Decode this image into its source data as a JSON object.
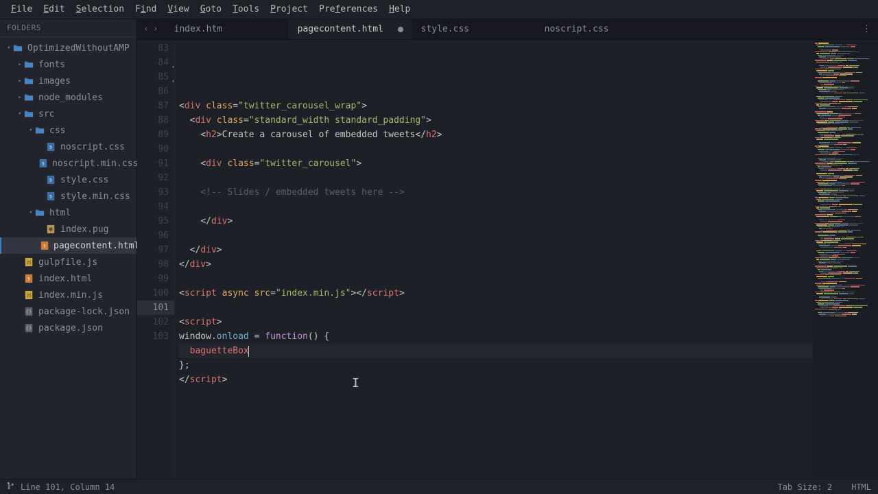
{
  "menu": {
    "items": [
      {
        "label": "File",
        "u": 0
      },
      {
        "label": "Edit",
        "u": 0
      },
      {
        "label": "Selection",
        "u": 0
      },
      {
        "label": "Find",
        "u": 1
      },
      {
        "label": "View",
        "u": 0
      },
      {
        "label": "Goto",
        "u": 0
      },
      {
        "label": "Tools",
        "u": 0
      },
      {
        "label": "Project",
        "u": 0
      },
      {
        "label": "Preferences",
        "u": 3
      },
      {
        "label": "Help",
        "u": 0
      }
    ]
  },
  "sidebar": {
    "header": "FOLDERS",
    "tree": [
      {
        "depth": 0,
        "kind": "folder-open",
        "label": "OptimizedWithoutAMP",
        "disclosure": "▾"
      },
      {
        "depth": 1,
        "kind": "folder",
        "label": "fonts",
        "disclosure": "▸"
      },
      {
        "depth": 1,
        "kind": "folder",
        "label": "images",
        "disclosure": "▸"
      },
      {
        "depth": 1,
        "kind": "folder",
        "label": "node_modules",
        "disclosure": "▸"
      },
      {
        "depth": 1,
        "kind": "folder-open",
        "label": "src",
        "disclosure": "▾"
      },
      {
        "depth": 2,
        "kind": "folder-open",
        "label": "css",
        "disclosure": "▾"
      },
      {
        "depth": 3,
        "kind": "css",
        "label": "noscript.css"
      },
      {
        "depth": 3,
        "kind": "css",
        "label": "noscript.min.css"
      },
      {
        "depth": 3,
        "kind": "css",
        "label": "style.css"
      },
      {
        "depth": 3,
        "kind": "css",
        "label": "style.min.css"
      },
      {
        "depth": 2,
        "kind": "folder-open",
        "label": "html",
        "disclosure": "▾"
      },
      {
        "depth": 3,
        "kind": "pug",
        "label": "index.pug"
      },
      {
        "depth": 3,
        "kind": "html",
        "label": "pagecontent.html",
        "active": true
      },
      {
        "depth": 1,
        "kind": "js",
        "label": "gulpfile.js"
      },
      {
        "depth": 1,
        "kind": "html",
        "label": "index.html"
      },
      {
        "depth": 1,
        "kind": "js",
        "label": "index.min.js"
      },
      {
        "depth": 1,
        "kind": "json",
        "label": "package-lock.json"
      },
      {
        "depth": 1,
        "kind": "json",
        "label": "package.json"
      }
    ]
  },
  "tabs": {
    "items": [
      {
        "label": "index.htm"
      },
      {
        "label": "pagecontent.html",
        "active": true,
        "dirty": true
      },
      {
        "label": "style.css"
      },
      {
        "label": "noscript.css"
      }
    ]
  },
  "editor": {
    "first_line": 83,
    "current_line": 101,
    "lines": [
      {
        "n": 83,
        "tokens": []
      },
      {
        "n": 84,
        "fold": true,
        "tokens": [
          [
            "punct",
            "<"
          ],
          [
            "tag",
            "div"
          ],
          [
            "text",
            " "
          ],
          [
            "attr",
            "class"
          ],
          [
            "punct",
            "="
          ],
          [
            "str",
            "\"twitter_carousel_wrap\""
          ],
          [
            "punct",
            ">"
          ]
        ]
      },
      {
        "n": 85,
        "indent": 1,
        "fold": true,
        "tokens": [
          [
            "punct",
            "<"
          ],
          [
            "tag",
            "div"
          ],
          [
            "text",
            " "
          ],
          [
            "attr",
            "class"
          ],
          [
            "punct",
            "="
          ],
          [
            "str",
            "\"standard_width standard_padding\""
          ],
          [
            "punct",
            ">"
          ]
        ]
      },
      {
        "n": 86,
        "indent": 2,
        "tokens": [
          [
            "punct",
            "<"
          ],
          [
            "tag",
            "h2"
          ],
          [
            "punct",
            ">"
          ],
          [
            "text",
            "Create a carousel of embedded tweets"
          ],
          [
            "punct",
            "</"
          ],
          [
            "tag",
            "h2"
          ],
          [
            "punct",
            ">"
          ]
        ]
      },
      {
        "n": 87,
        "tokens": []
      },
      {
        "n": 88,
        "indent": 2,
        "tokens": [
          [
            "punct",
            "<"
          ],
          [
            "tag",
            "div"
          ],
          [
            "text",
            " "
          ],
          [
            "attr",
            "class"
          ],
          [
            "punct",
            "="
          ],
          [
            "str",
            "\"twitter_carousel\""
          ],
          [
            "punct",
            ">"
          ]
        ]
      },
      {
        "n": 89,
        "tokens": []
      },
      {
        "n": 90,
        "indent": 2,
        "tokens": [
          [
            "cmt",
            "<!-- Slides / embedded tweets here -->"
          ]
        ]
      },
      {
        "n": 91,
        "tokens": []
      },
      {
        "n": 92,
        "indent": 2,
        "tokens": [
          [
            "punct",
            "</"
          ],
          [
            "tag",
            "div"
          ],
          [
            "punct",
            ">"
          ]
        ]
      },
      {
        "n": 93,
        "tokens": []
      },
      {
        "n": 94,
        "indent": 1,
        "tokens": [
          [
            "punct",
            "</"
          ],
          [
            "tag",
            "div"
          ],
          [
            "punct",
            ">"
          ]
        ]
      },
      {
        "n": 95,
        "tokens": [
          [
            "punct",
            "</"
          ],
          [
            "tag",
            "div"
          ],
          [
            "punct",
            ">"
          ]
        ]
      },
      {
        "n": 96,
        "tokens": []
      },
      {
        "n": 97,
        "tokens": [
          [
            "punct",
            "<"
          ],
          [
            "tag",
            "script"
          ],
          [
            "text",
            " "
          ],
          [
            "attr",
            "async"
          ],
          [
            "text",
            " "
          ],
          [
            "attr",
            "src"
          ],
          [
            "punct",
            "="
          ],
          [
            "str",
            "\"index.min.js\""
          ],
          [
            "punct",
            ">"
          ],
          [
            "punct",
            "</"
          ],
          [
            "tag",
            "script"
          ],
          [
            "punct",
            ">"
          ]
        ]
      },
      {
        "n": 98,
        "tokens": []
      },
      {
        "n": 99,
        "tokens": [
          [
            "punct",
            "<"
          ],
          [
            "tag",
            "script"
          ],
          [
            "punct",
            ">"
          ]
        ]
      },
      {
        "n": 100,
        "tokens": [
          [
            "obj",
            "window"
          ],
          [
            "punct",
            "."
          ],
          [
            "fn",
            "onload"
          ],
          [
            "text",
            " "
          ],
          [
            "punct",
            "="
          ],
          [
            "text",
            " "
          ],
          [
            "kw",
            "function"
          ],
          [
            "punct",
            "()"
          ],
          [
            "text",
            " "
          ],
          [
            "punct",
            "{"
          ]
        ]
      },
      {
        "n": 101,
        "indent": 1,
        "current": true,
        "tokens": [
          [
            "var",
            "baguetteBox"
          ]
        ],
        "cursor_after": true
      },
      {
        "n": 102,
        "tokens": [
          [
            "punct",
            "};"
          ]
        ]
      },
      {
        "n": 103,
        "tokens": [
          [
            "punct",
            "</"
          ],
          [
            "tag",
            "script"
          ],
          [
            "punct",
            ">"
          ]
        ]
      }
    ]
  },
  "statusbar": {
    "position": "Line 101, Column 14",
    "tabsize": "Tab Size: 2",
    "syntax": "HTML"
  }
}
